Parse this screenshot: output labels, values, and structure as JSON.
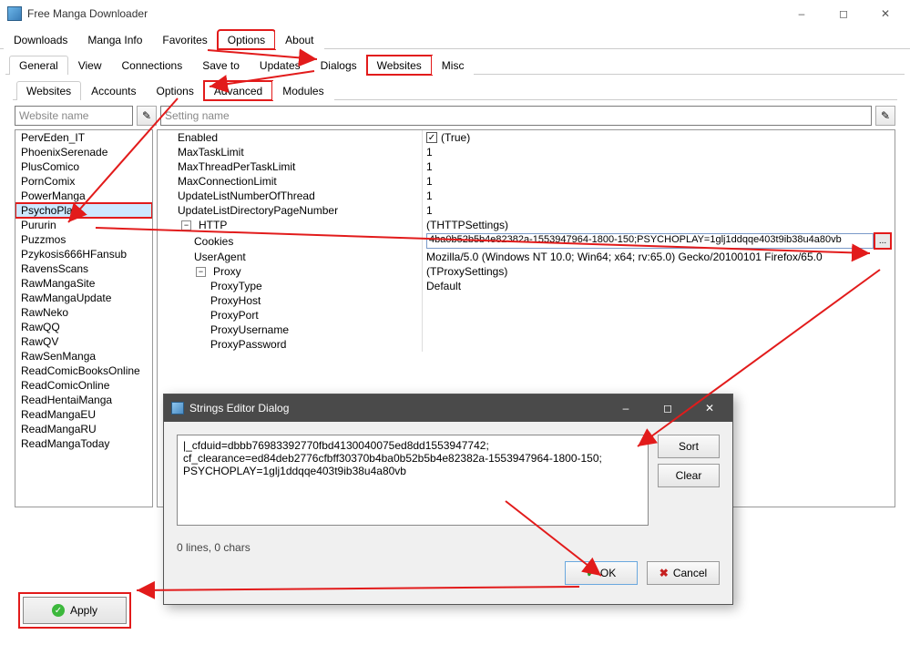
{
  "window": {
    "title": "Free Manga Downloader"
  },
  "main_tabs": {
    "downloads": "Downloads",
    "manga_info": "Manga Info",
    "favorites": "Favorites",
    "options": "Options",
    "about": "About"
  },
  "options_tabs": {
    "general": "General",
    "view": "View",
    "connections": "Connections",
    "save_to": "Save to",
    "updates": "Updates",
    "dialogs": "Dialogs",
    "websites": "Websites",
    "misc": "Misc"
  },
  "websites_tabs": {
    "websites": "Websites",
    "accounts": "Accounts",
    "options": "Options",
    "advanced": "Advanced",
    "modules": "Modules"
  },
  "filters": {
    "website_placeholder": "Website name",
    "setting_placeholder": "Setting name"
  },
  "website_list": [
    "PervEden_IT",
    "PhoenixSerenade",
    "PlusComico",
    "PornComix",
    "PowerManga",
    "PsychoPlay",
    "Pururin",
    "Puzzmos",
    "Pzykosis666HFansub",
    "RavensScans",
    "RawMangaSite",
    "RawMangaUpdate",
    "RawNeko",
    "RawQQ",
    "RawQV",
    "RawSenManga",
    "ReadComicBooksOnline",
    "ReadComicOnline",
    "ReadHentaiManga",
    "ReadMangaEU",
    "ReadMangaRU",
    "ReadMangaToday"
  ],
  "selected_website_index": 5,
  "props": {
    "enabled_label": "Enabled",
    "enabled_value": "(True)",
    "maxtasklimit_label": "MaxTaskLimit",
    "maxtasklimit_value": "1",
    "maxthreadpertasklimit_label": "MaxThreadPerTaskLimit",
    "maxthreadpertasklimit_value": "1",
    "maxconnectionlimit_label": "MaxConnectionLimit",
    "maxconnectionlimit_value": "1",
    "updatelistthreads_label": "UpdateListNumberOfThread",
    "updatelistthreads_value": "1",
    "updatelistpages_label": "UpdateListDirectoryPageNumber",
    "updatelistpages_value": "1",
    "http_label": "HTTP",
    "http_value": "(THTTPSettings)",
    "cookies_label": "Cookies",
    "cookies_value": "4ba0b52b5b4e82382a-1553947964-1800-150;PSYCHOPLAY=1glj1ddqqe403t9ib38u4a80vb",
    "useragent_label": "UserAgent",
    "useragent_value": "Mozilla/5.0 (Windows NT 10.0; Win64; x64; rv:65.0) Gecko/20100101 Firefox/65.0",
    "proxy_label": "Proxy",
    "proxy_value": "(TProxySettings)",
    "proxydefault_value": "Default",
    "proxytype_label": "ProxyType",
    "proxyhost_label": "ProxyHost",
    "proxyport_label": "ProxyPort",
    "proxyusername_label": "ProxyUsername",
    "proxypassword_label": "ProxyPassword"
  },
  "apply_label": "Apply",
  "dialog": {
    "title": "Strings Editor Dialog",
    "text": "|_cfduid=dbbb76983392770fbd4130040075ed8dd1553947742;\ncf_clearance=ed84deb2776cfbff30370b4ba0b52b5b4e82382a-1553947964-1800-150;\nPSYCHOPLAY=1glj1ddqqe403t9ib38u4a80vb",
    "sort": "Sort",
    "clear": "Clear",
    "status": "0 lines, 0 chars",
    "ok": "OK",
    "cancel": "Cancel"
  }
}
